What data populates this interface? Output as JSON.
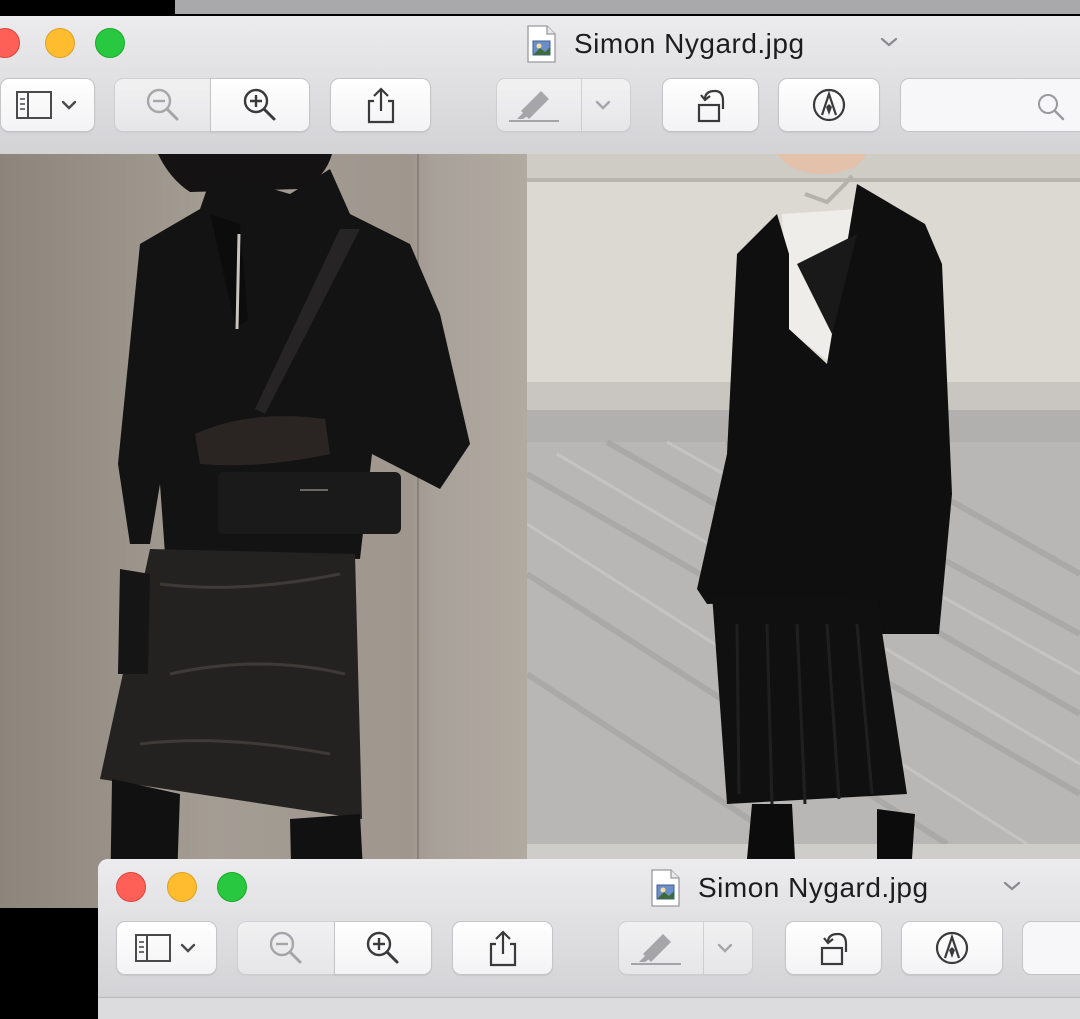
{
  "window_main": {
    "title": "Simon Nygard.jpg",
    "file_icon": "document-preview-icon",
    "toolbar": {
      "sidebar_toggle_icon": "sidebar-icon",
      "zoom_out_icon": "zoom-out-icon",
      "zoom_in_icon": "zoom-in-icon",
      "share_icon": "share-icon",
      "markup_pen_icon": "highlighter-icon",
      "rotate_icon": "rotate-left-icon",
      "annotate_icon": "markup-icon",
      "search_icon": "search-icon",
      "search_value": ""
    }
  },
  "window_secondary": {
    "title": "Simon Nygard.jpg",
    "file_icon": "document-preview-icon"
  },
  "colors": {
    "close": "#fe5f57",
    "minimize": "#febc2e",
    "maximize": "#28c840",
    "toolbar_bg": "#e4e4e6"
  }
}
